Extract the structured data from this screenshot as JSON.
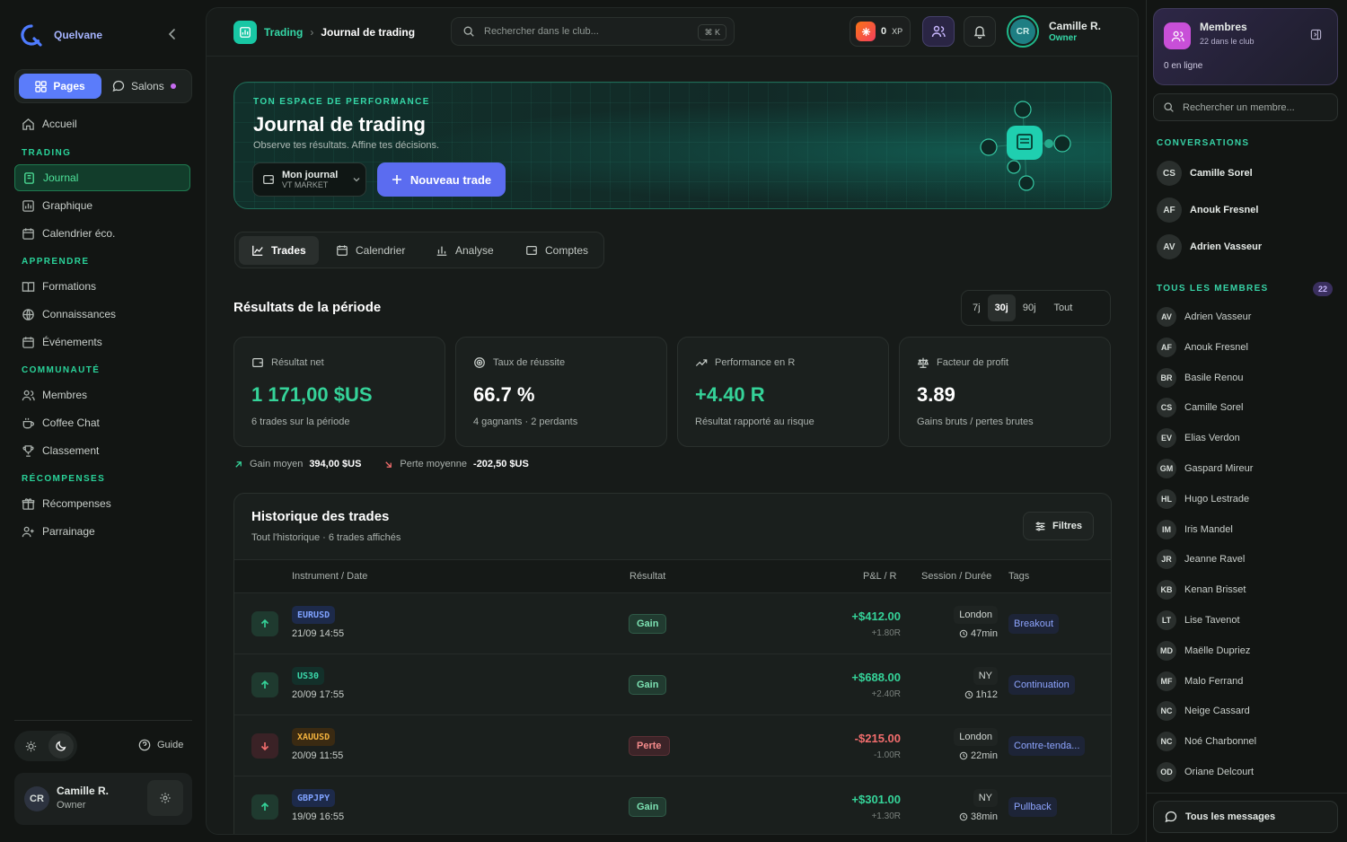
{
  "app": {
    "name": "Quelvane"
  },
  "sidebar": {
    "segment": {
      "pages": "Pages",
      "salons": "Salons"
    },
    "home": "Accueil",
    "sections": [
      {
        "title": "TRADING",
        "items": [
          {
            "label": "Journal",
            "icon": "journal-icon",
            "active": true
          },
          {
            "label": "Graphique",
            "icon": "chart-icon"
          },
          {
            "label": "Calendrier éco.",
            "icon": "calendar-icon"
          }
        ]
      },
      {
        "title": "APPRENDRE",
        "items": [
          {
            "label": "Formations",
            "icon": "book-icon"
          },
          {
            "label": "Connaissances",
            "icon": "globe-icon"
          },
          {
            "label": "Événements",
            "icon": "calendar-icon"
          }
        ]
      },
      {
        "title": "COMMUNAUTÉ",
        "items": [
          {
            "label": "Membres",
            "icon": "users-icon"
          },
          {
            "label": "Coffee Chat",
            "icon": "coffee-icon"
          },
          {
            "label": "Classement",
            "icon": "trophy-icon"
          }
        ]
      },
      {
        "title": "RÉCOMPENSES",
        "items": [
          {
            "label": "Récompenses",
            "icon": "gift-icon"
          },
          {
            "label": "Parrainage",
            "icon": "user-plus-icon"
          }
        ]
      }
    ],
    "guide": "Guide",
    "user": {
      "initials": "CR",
      "name": "Camille R.",
      "role": "Owner"
    }
  },
  "topbar": {
    "breadcrumb": [
      "Trading",
      "Journal de trading"
    ],
    "search_placeholder": "Rechercher dans le club...",
    "shortcut": "⌘ K",
    "xp_value": "0",
    "xp_unit": "XP",
    "user": {
      "initials": "CR",
      "name": "Camille R.",
      "role": "Owner"
    }
  },
  "hero": {
    "eyebrow": "TON ESPACE DE PERFORMANCE",
    "title": "Journal de trading",
    "subtitle": "Observe tes résultats. Affine tes décisions.",
    "journal_select": {
      "title": "Mon journal",
      "sub": "VT MARKET"
    },
    "new_trade": "Nouveau trade"
  },
  "tabs": [
    "Trades",
    "Calendrier",
    "Analyse",
    "Comptes"
  ],
  "period": {
    "title": "Résultats de la période",
    "ranges": [
      "7j",
      "30j",
      "90j",
      "Tout"
    ],
    "selected": "30j"
  },
  "kpis": [
    {
      "label": "Résultat net",
      "value": "1 171,00 $US",
      "sub": "6 trades sur la période",
      "color": "#35d399",
      "icon": "wallet-icon"
    },
    {
      "label": "Taux de réussite",
      "value": "66.7 %",
      "sub": "4 gagnants · 2 perdants",
      "color": "#ffffff",
      "icon": "target-icon"
    },
    {
      "label": "Performance en R",
      "value": "+4.40 R",
      "sub": "Résultat rapporté au risque",
      "color": "#35d399",
      "icon": "trend-up-icon"
    },
    {
      "label": "Facteur de profit",
      "value": "3.89",
      "sub": "Gains bruts / pertes brutes",
      "color": "#ffffff",
      "icon": "scale-icon"
    }
  ],
  "averages": {
    "gain_label": "Gain moyen",
    "gain_value": "394,00 $US",
    "loss_label": "Perte moyenne",
    "loss_value": "-202,50 $US"
  },
  "history": {
    "title": "Historique des trades",
    "subtitle": "Tout l'historique · 6 trades affichés",
    "filters": "Filtres",
    "columns": [
      "Instrument / Date",
      "Résultat",
      "P&L / R",
      "Session / Durée",
      "Tags"
    ],
    "rows": [
      {
        "dir": "up",
        "symbol": "EURUSD",
        "date": "21/09 14:55",
        "result": "Gain",
        "pnl": "+$412.00",
        "r": "+1.80R",
        "session": "London",
        "duration": "47min",
        "tag": "Breakout"
      },
      {
        "dir": "up",
        "symbol": "US30",
        "date": "20/09 17:55",
        "result": "Gain",
        "pnl": "+$688.00",
        "r": "+2.40R",
        "session": "NY",
        "duration": "1h12",
        "tag": "Continuation"
      },
      {
        "dir": "down",
        "symbol": "XAUUSD",
        "date": "20/09 11:55",
        "result": "Perte",
        "pnl": "-$215.00",
        "r": "-1.00R",
        "session": "London",
        "duration": "22min",
        "tag": "Contre-tenda..."
      },
      {
        "dir": "up",
        "symbol": "GBPJPY",
        "date": "19/09 16:55",
        "result": "Gain",
        "pnl": "+$301.00",
        "r": "+1.30R",
        "session": "NY",
        "duration": "38min",
        "tag": "Pullback"
      }
    ]
  },
  "right_panel": {
    "members_card": {
      "title": "Membres",
      "sub": "22 dans le club",
      "online": "0 en ligne"
    },
    "search_placeholder": "Rechercher un membre...",
    "conversations_title": "CONVERSATIONS",
    "conversations": [
      {
        "initials": "CS",
        "name": "Camille Sorel"
      },
      {
        "initials": "AF",
        "name": "Anouk Fresnel"
      },
      {
        "initials": "AV",
        "name": "Adrien Vasseur"
      }
    ],
    "members_title": "TOUS LES MEMBRES",
    "members_count": "22",
    "members": [
      {
        "initials": "AV",
        "name": "Adrien Vasseur"
      },
      {
        "initials": "AF",
        "name": "Anouk Fresnel"
      },
      {
        "initials": "BR",
        "name": "Basile Renou"
      },
      {
        "initials": "CS",
        "name": "Camille Sorel"
      },
      {
        "initials": "EV",
        "name": "Elias Verdon"
      },
      {
        "initials": "GM",
        "name": "Gaspard Mireur"
      },
      {
        "initials": "HL",
        "name": "Hugo Lestrade"
      },
      {
        "initials": "IM",
        "name": "Iris Mandel"
      },
      {
        "initials": "JR",
        "name": "Jeanne Ravel"
      },
      {
        "initials": "KB",
        "name": "Kenan Brisset"
      },
      {
        "initials": "LT",
        "name": "Lise Tavenot"
      },
      {
        "initials": "MD",
        "name": "Maëlle Dupriez"
      },
      {
        "initials": "MF",
        "name": "Malo Ferrand"
      },
      {
        "initials": "NC",
        "name": "Neige Cassard"
      },
      {
        "initials": "NC",
        "name": "Noé Charbonnel"
      },
      {
        "initials": "OD",
        "name": "Oriane Delcourt"
      }
    ],
    "all_messages": "Tous les messages"
  },
  "colors": {
    "accent": "#35d399",
    "brand": "#5b6cf0",
    "loss": "#f26d6d"
  }
}
